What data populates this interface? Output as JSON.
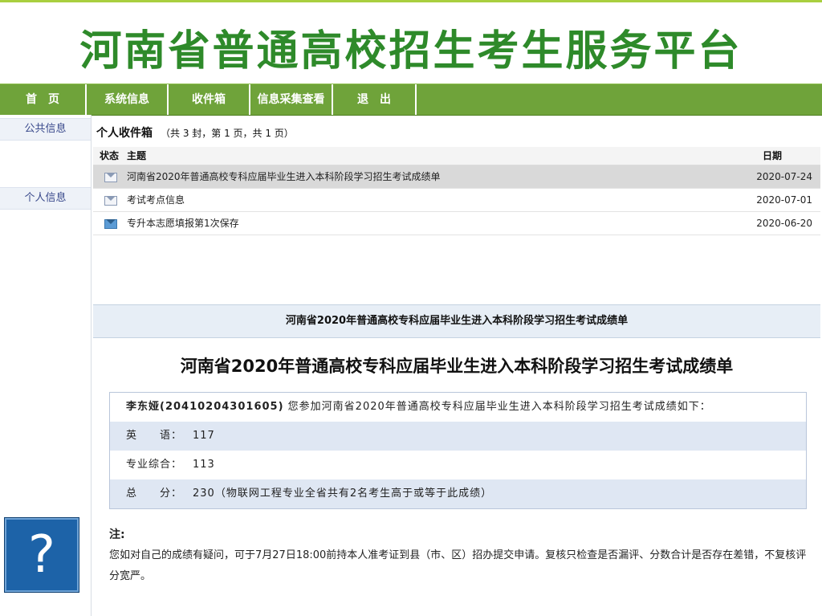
{
  "header": {
    "title": "河南省普通高校招生考生服务平台"
  },
  "nav": [
    {
      "label": "首　页"
    },
    {
      "label": "系统信息"
    },
    {
      "label": "收件箱"
    },
    {
      "label": "信息采集查看"
    },
    {
      "label": "退　出"
    }
  ],
  "sidebar": {
    "items": [
      {
        "label": "公共信息"
      },
      {
        "label": "个人信息"
      }
    ],
    "help_symbol": "?"
  },
  "inbox": {
    "title": "个人收件箱",
    "summary": "（共 3 封，第 1 页，共 1 页）",
    "columns": {
      "status": "状态",
      "subject": "主题",
      "date": "日期"
    },
    "rows": [
      {
        "subject": "河南省2020年普通高校专科应届毕业生进入本科阶段学习招生考试成绩单",
        "date": "2020-07-24"
      },
      {
        "subject": "考试考点信息",
        "date": "2020-07-01"
      },
      {
        "subject": "专升本志愿填报第1次保存",
        "date": "2020-06-20"
      }
    ]
  },
  "detail": {
    "bar_title": "河南省2020年普通高校专科应届毕业生进入本科阶段学习招生考试成绩单",
    "title": "河南省2020年普通高校专科应届毕业生进入本科阶段学习招生考试成绩单",
    "student": "李东娅(20410204301605)",
    "intro_rest": "您参加河南省2020年普通高校专科应届毕业生进入本科阶段学习招生考试成绩如下：",
    "scores": [
      {
        "label": "英　　语：",
        "value": "117"
      },
      {
        "label": "专业综合：",
        "value": "113"
      },
      {
        "label": "总　　分：",
        "value": "230（物联网工程专业全省共有2名考生高于或等于此成绩）"
      }
    ],
    "note_label": "注:",
    "note_text": "您如对自己的成绩有疑问，可于7月27日18:00前持本人准考证到县（市、区）招办提交申请。复核只检查是否漏评、分数合计是否存在差错，不复核评分宽严。"
  }
}
